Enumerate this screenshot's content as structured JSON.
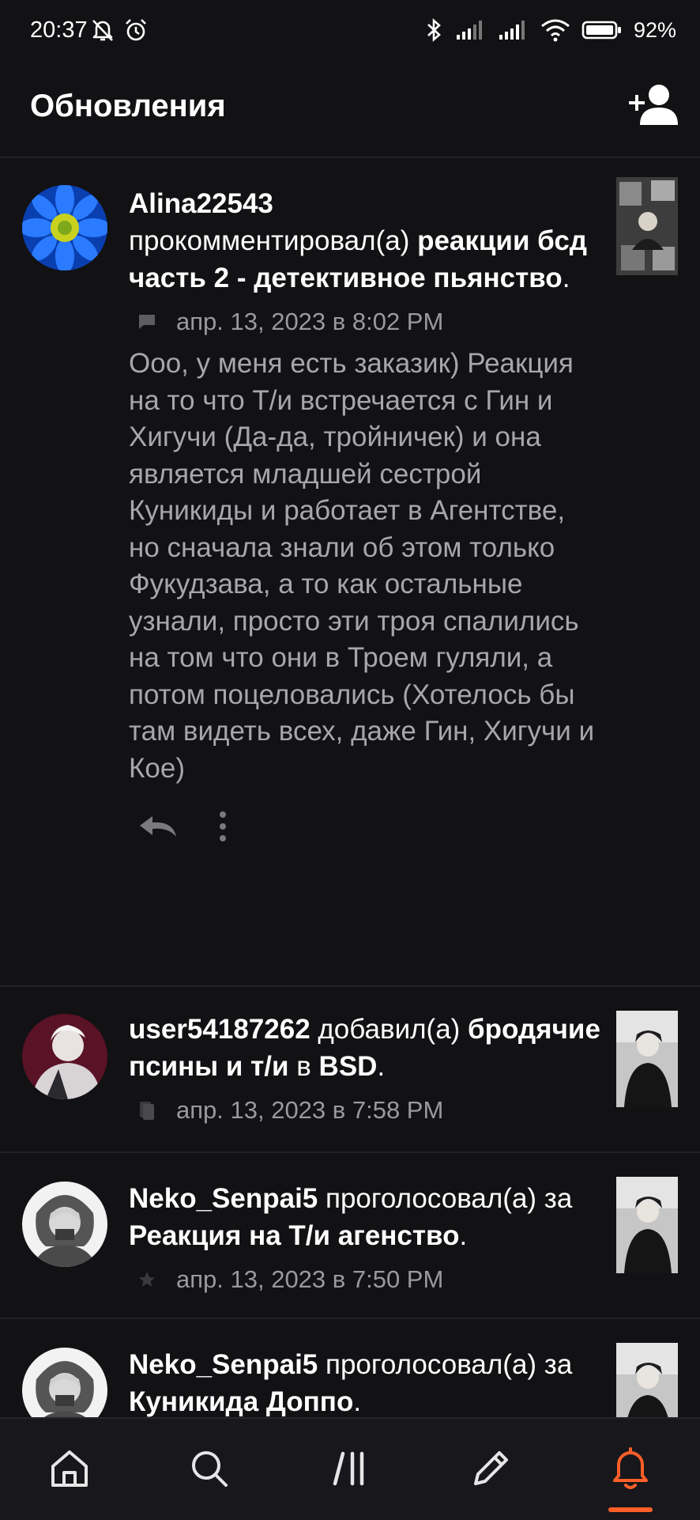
{
  "status_bar": {
    "time": "20:37",
    "battery": "92%"
  },
  "header": {
    "title": "Обновления"
  },
  "feed": [
    {
      "user": "Alina22543",
      "action": " прокомментировал(а) ",
      "target": "реакции бсд часть 2 - детективное пьянство",
      "suffix": ".",
      "date": "апр. 13, 2023 в 8:02 PM",
      "meta_icon": "comment-icon",
      "comment": "Ооо, у меня есть заказик) Реакция на то что Т/и встречается с Гин и Хигучи (Да-да, тройничек) и она является младшей сестрой Куникиды и работает в Агентстве, но сначала знали об этом только Фукудзава, а то как остальные узнали, просто эти троя спалились на том что они в Троем гуляли, а потом поцеловались (Хотелось бы там видеть всех, даже Гин, Хигучи и Кое)"
    },
    {
      "user": "user54187262",
      "action": " добавил(а) ",
      "target": "бродячие псины и т/и",
      "extra": " в ",
      "list": "BSD",
      "suffix": ".",
      "date": "апр. 13, 2023 в 7:58 PM",
      "meta_icon": "library-icon"
    },
    {
      "user": "Neko_Senpai5",
      "action": " проголосовал(а) за ",
      "target": "Реакция на Т/и агенство",
      "suffix": ".",
      "date": "апр. 13, 2023 в 7:50 PM",
      "meta_icon": "star-icon"
    },
    {
      "user": "Neko_Senpai5",
      "action": " проголосовал(а) за ",
      "target": "Куникида Доппо",
      "suffix": "."
    }
  ],
  "nav": {
    "items": [
      "home-icon",
      "search-icon",
      "library-icon",
      "write-icon",
      "notifications-icon"
    ],
    "active": "notifications-icon",
    "accent": "#ff5f28"
  }
}
